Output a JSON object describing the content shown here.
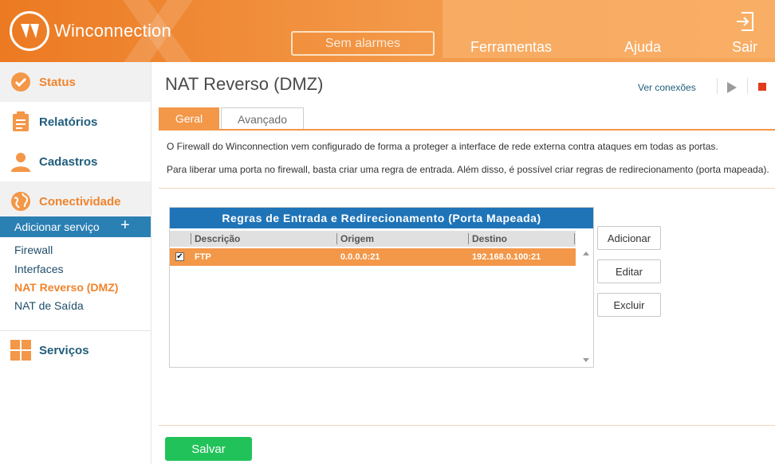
{
  "header": {
    "brand": "Winconnection",
    "alarm": "Sem alarmes",
    "nav": {
      "tools": "Ferramentas",
      "help": "Ajuda",
      "exit": "Sair"
    }
  },
  "sidebar": {
    "status": "Status",
    "reports": "Relatórios",
    "registrations": "Cadastros",
    "connectivity": "Conectividade",
    "add_service": "Adicionar serviço",
    "add_plus": "+",
    "subitems": [
      "Firewall",
      "Interfaces",
      "NAT Reverso (DMZ)",
      "NAT de Saída"
    ],
    "services": "Serviços"
  },
  "main": {
    "title": "NAT Reverso (DMZ)",
    "view_connections": "Ver conexões",
    "tabs": [
      "Geral",
      "Avançado"
    ],
    "desc1": "O Firewall do Winconnection vem configurado de forma a proteger a interface de rede externa contra ataques em todas as portas.",
    "desc2": "Para liberar uma porta no firewall, basta criar uma regra de entrada. Além disso, é possível criar regras de redirecionamento (porta mapeada).",
    "grid": {
      "title": "Regras de Entrada e Redirecionamento (Porta Mapeada)",
      "columns": [
        "Descrição",
        "Origem",
        "Destino"
      ],
      "rows": [
        {
          "checked": "✔",
          "desc": "FTP",
          "origin": "0.0.0.0:21",
          "dest": "192.168.0.100:21"
        }
      ]
    },
    "actions": {
      "add": "Adicionar",
      "edit": "Editar",
      "delete": "Excluir"
    },
    "save": "Salvar"
  },
  "colors": {
    "accent": "#f0842c",
    "blue": "#1f74b8",
    "save": "#22c25a"
  },
  "icons": [
    "logo-icon",
    "exit-icon",
    "check-circle-icon",
    "clipboard-icon",
    "user-icon",
    "globe-icon",
    "grid-icon",
    "play-icon",
    "stop-icon"
  ]
}
